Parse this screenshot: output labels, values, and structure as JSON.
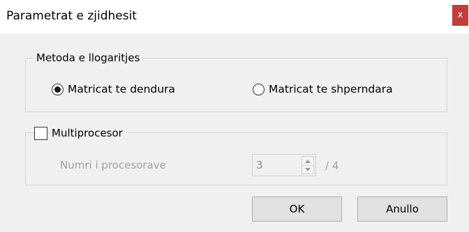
{
  "window": {
    "title": "Parametrat e zjidhesit",
    "close_glyph": "x"
  },
  "method_group": {
    "legend": "Metoda e llogaritjes",
    "options": [
      {
        "label": "Matricat te dendura",
        "selected": true
      },
      {
        "label": "Matricat te shperndara",
        "selected": false
      }
    ]
  },
  "multiprocessor_group": {
    "checkbox_label": "Multiprocesor",
    "checked": false,
    "processors_label": "Numri i procesorave",
    "processors_value": "3",
    "processors_max": "/ 4"
  },
  "buttons": {
    "ok_label": "OK",
    "cancel_label": "Anullo"
  },
  "colors": {
    "close_button_bg": "#c43c3c",
    "window_bg": "#f0f0f0",
    "disabled_text": "#a0a0a0"
  }
}
